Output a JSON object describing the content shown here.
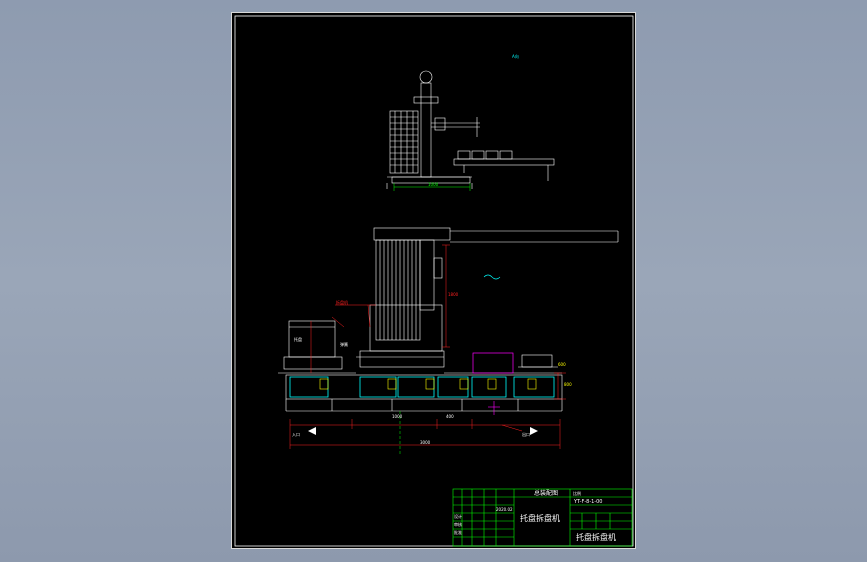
{
  "drawing": {
    "view_label_top": "A向",
    "dim_top_view": "1000",
    "dim_main_vertical": "1800",
    "dim_bottom_total": "3000",
    "dim_bottom_left": "1000",
    "dim_bottom_mid": "400",
    "dim_right_height": "800",
    "dim_right_width": "600",
    "label_stacker": "拆盘机",
    "label_tray": "托盘",
    "label_entry": "入口",
    "label_exit": "出口",
    "label_spring": "弹簧"
  },
  "title_block": {
    "title": "托盘拆盘机",
    "scale_label": "比例",
    "drawing_no": "YT-F-8-1-00",
    "company": "总装配图",
    "bottom_right": "托盘拆盘机",
    "design": "设计",
    "check": "审核",
    "approve": "批准",
    "date": "2020.02"
  },
  "colors": {
    "white": "#ffffff",
    "green": "#00ff00",
    "red": "#ff2020",
    "cyan": "#00ffff",
    "magenta": "#ff00ff",
    "yellow": "#ffff00"
  }
}
